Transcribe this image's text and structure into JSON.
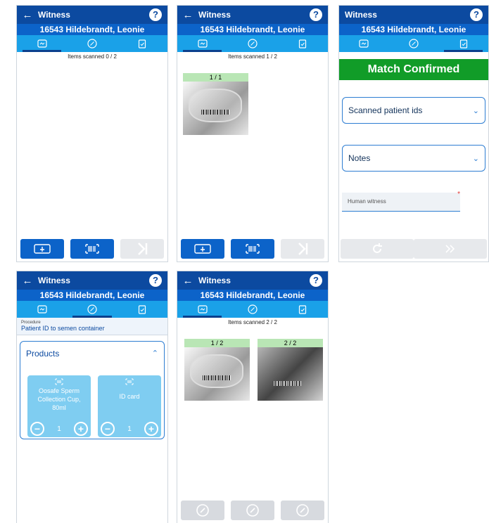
{
  "common": {
    "title": "Witness",
    "patient": "16543 Hildebrandt, Leonie",
    "help": "?",
    "back": "←"
  },
  "p1": {
    "scanned": "Items scanned 0 / 2"
  },
  "p2": {
    "scanned": "Items scanned 1 / 2",
    "cards": [
      "1 / 1"
    ]
  },
  "p3": {
    "confirmed": "Match Confirmed",
    "ids_label": "Scanned patient ids",
    "notes_label": "Notes",
    "witness_placeholder": "Human witness",
    "required_mark": "*"
  },
  "p4": {
    "procedure_label": "Procedure",
    "procedure_value": "Patient ID to semen container",
    "products_title": "Products",
    "products": [
      {
        "name": "Oosafe Sperm Collection Cup, 80ml",
        "qty": "1"
      },
      {
        "name": "ID card",
        "qty": "1"
      }
    ]
  },
  "p5": {
    "scanned": "Items scanned 2 / 2",
    "cards": [
      "1 / 2",
      "2 / 2"
    ]
  },
  "colors": {
    "appbar": "#0c4aa0",
    "tabs": "#1aa1e8",
    "confirm": "#119c28",
    "product": "#7fcdf1"
  }
}
